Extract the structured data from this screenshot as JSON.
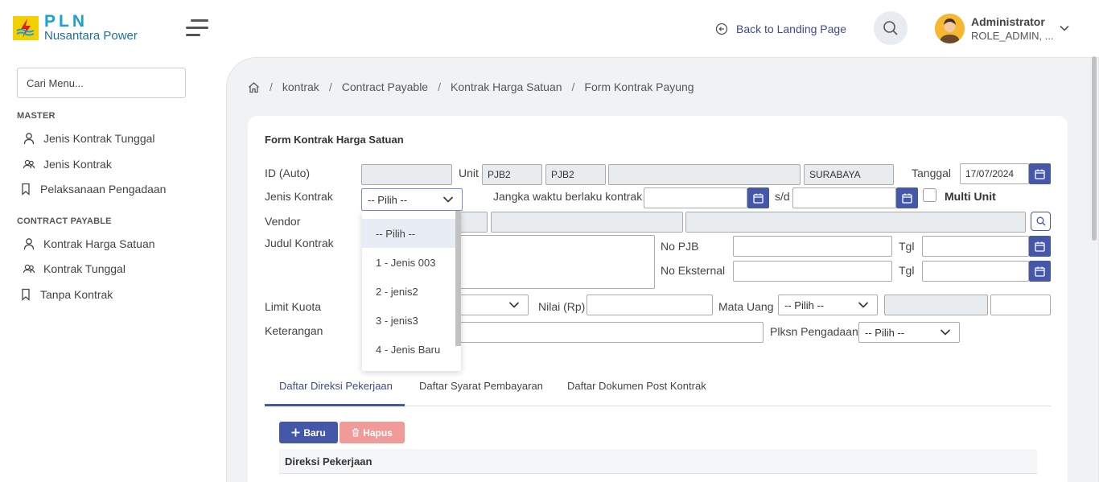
{
  "brand": {
    "pln": "PLN",
    "subtitle": "Nusantara Power"
  },
  "header": {
    "back_link": "Back to Landing Page",
    "user_name": "Administrator",
    "user_role": "ROLE_ADMIN, ..."
  },
  "sidebar": {
    "search_placeholder": "Cari Menu...",
    "sections": [
      {
        "title": "MASTER",
        "items": [
          {
            "label": "Jenis Kontrak Tunggal",
            "icon": "user-icon"
          },
          {
            "label": "Jenis Kontrak",
            "icon": "users-icon"
          },
          {
            "label": "Pelaksanaan Pengadaan",
            "icon": "bookmark-icon"
          }
        ]
      },
      {
        "title": "CONTRACT PAYABLE",
        "items": [
          {
            "label": "Kontrak Harga Satuan",
            "icon": "user-icon"
          },
          {
            "label": "Kontrak Tunggal",
            "icon": "users-icon"
          },
          {
            "label": "Tanpa Kontrak",
            "icon": "bookmark-icon"
          }
        ]
      }
    ]
  },
  "breadcrumb": [
    "kontrak",
    "Contract Payable",
    "Kontrak Harga Satuan",
    "Form Kontrak Payung"
  ],
  "form": {
    "title": "Form Kontrak Harga Satuan",
    "labels": {
      "id": "ID (Auto)",
      "unit": "Unit",
      "tanggal": "Tanggal",
      "jenis_kontrak": "Jenis Kontrak",
      "jangka_waktu": "Jangka waktu berlaku kontrak",
      "sd": "s/d",
      "multi_unit": "Multi Unit",
      "vendor": "Vendor",
      "judul_kontrak": "Judul Kontrak",
      "no_pjb": "No PJB",
      "tgl": "Tgl",
      "no_eksternal": "No Eksternal",
      "limit_kuota": "Limit Kuota",
      "nilai": "Nilai (Rp)",
      "mata_uang": "Mata Uang",
      "keterangan": "Keterangan",
      "plksn_pengadaan": "Plksn Pengadaan"
    },
    "values": {
      "unit_code_1": "PJB2",
      "unit_code_2": "PJB2",
      "unit_city": "SURABAYA",
      "tanggal": "17/07/2024",
      "jenis_kontrak_selected": "-- Pilih --",
      "mata_uang_selected": "-- Pilih --",
      "plksn_pengadaan_selected": "-- Pilih --"
    },
    "jenis_kontrak_options": [
      "-- Pilih --",
      "1 - Jenis 003",
      "2 - jenis2",
      "3 - jenis3",
      "4 - Jenis Baru"
    ]
  },
  "tabs": [
    "Daftar Direksi Pekerjaan",
    "Daftar Syarat Pembayaran",
    "Daftar Dokumen Post Kontrak"
  ],
  "actions": {
    "baru": "Baru",
    "hapus": "Hapus"
  },
  "table": {
    "header": "Direksi Pekerjaan"
  },
  "colors": {
    "primary": "#4557a8",
    "danger_light": "#f09a9a",
    "brand_yellow": "#f5d000",
    "brand_blue": "#1aa0d8"
  }
}
